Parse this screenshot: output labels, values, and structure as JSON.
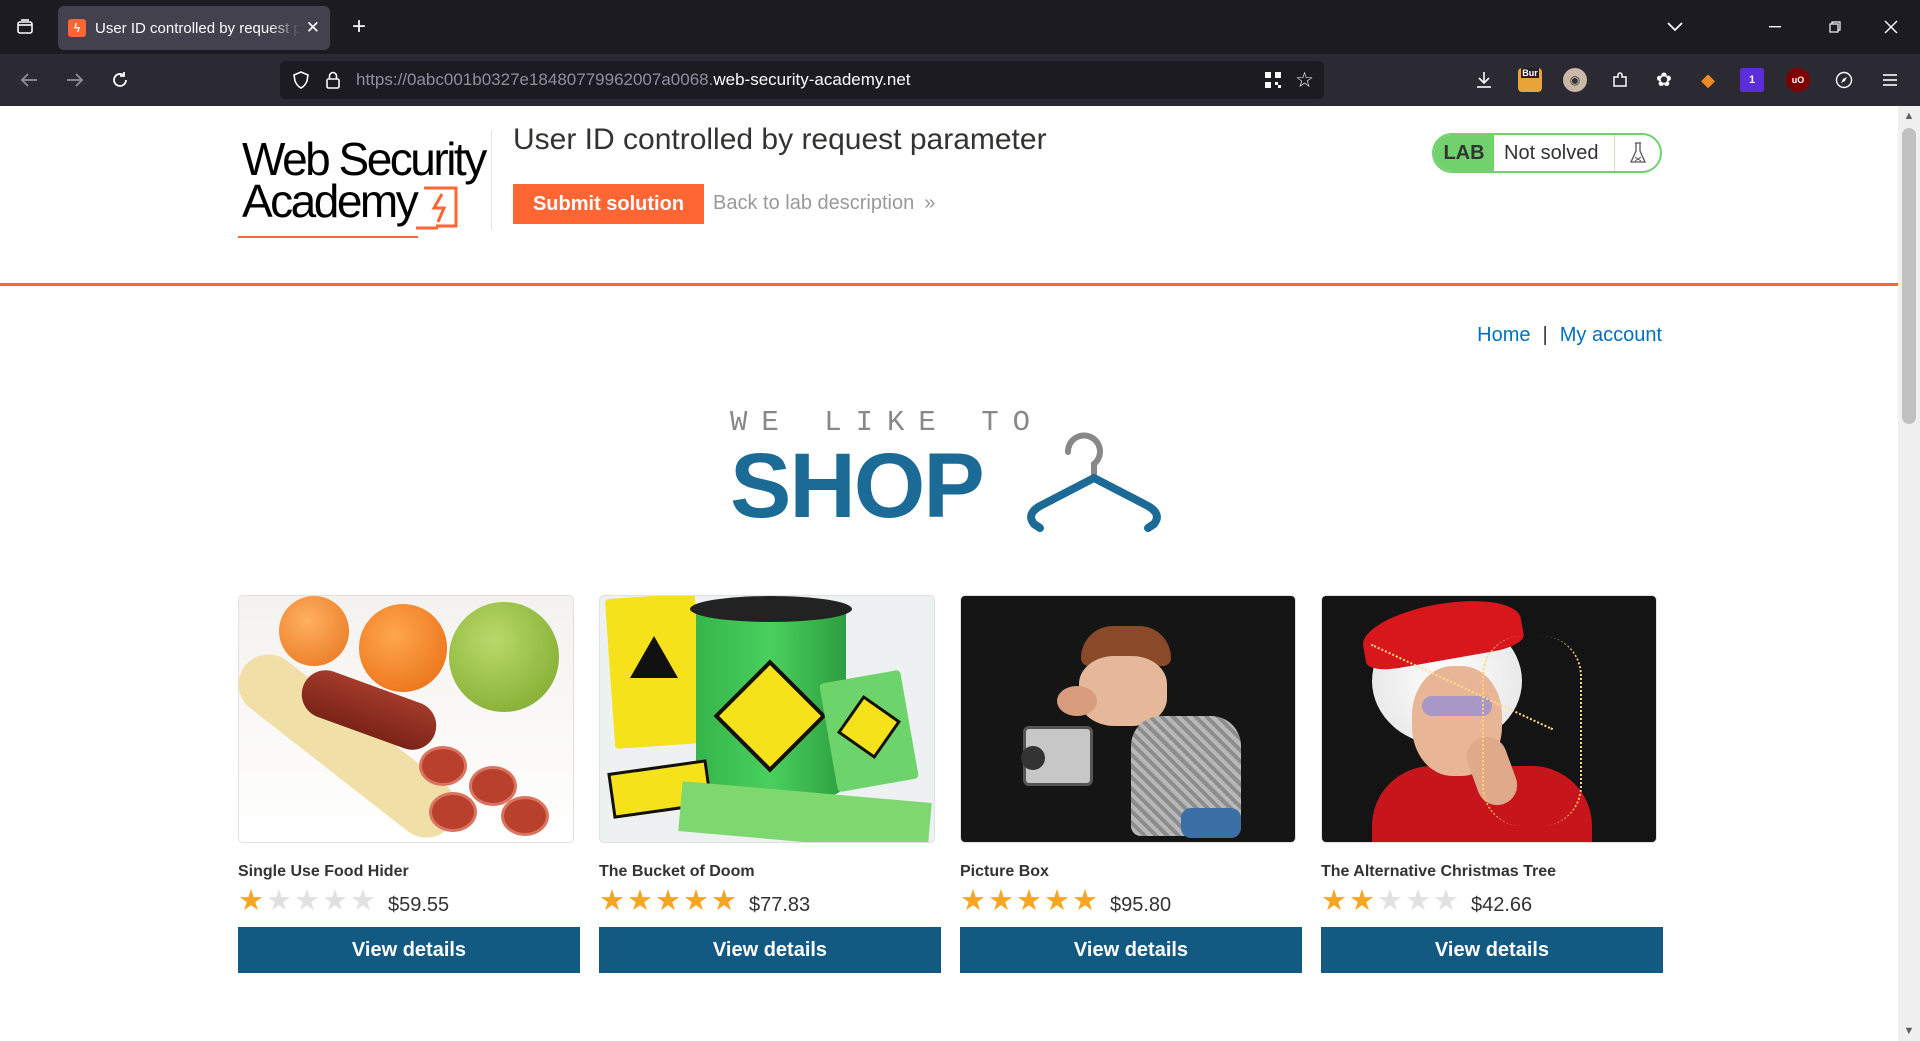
{
  "browser": {
    "tab_title": "User ID controlled by request parameter",
    "url_prefix": "https://0abc001b0327e18480779962007a0068.",
    "url_domain": "web-security-academy.net",
    "ext_burp_label": "Bur",
    "ext_badge": "1"
  },
  "header": {
    "logo_line1": "Web Security",
    "logo_line2": "Academy",
    "lab_title": "User ID controlled by request parameter",
    "submit_label": "Submit solution",
    "back_label": "Back to lab description",
    "back_chevron": "»",
    "status_tag": "LAB",
    "status_text": "Not solved"
  },
  "nav": {
    "home": "Home",
    "separator": "|",
    "account": "My account"
  },
  "banner": {
    "top": "WE LIKE TO",
    "main": "SHOP"
  },
  "products": [
    {
      "name": "Single Use Food Hider",
      "rating": 1,
      "price": "$59.55",
      "button": "View details"
    },
    {
      "name": "The Bucket of Doom",
      "rating": 5,
      "price": "$77.83",
      "button": "View details"
    },
    {
      "name": "Picture Box",
      "rating": 5,
      "price": "$95.80",
      "button": "View details"
    },
    {
      "name": "The Alternative Christmas Tree",
      "rating": 2,
      "price": "$42.66",
      "button": "View details"
    }
  ],
  "colors": {
    "accent_orange": "#ff6633",
    "button_blue": "#135a82",
    "link_blue": "#0071bc",
    "lab_green": "#70d16d",
    "star": "#f5a623"
  }
}
